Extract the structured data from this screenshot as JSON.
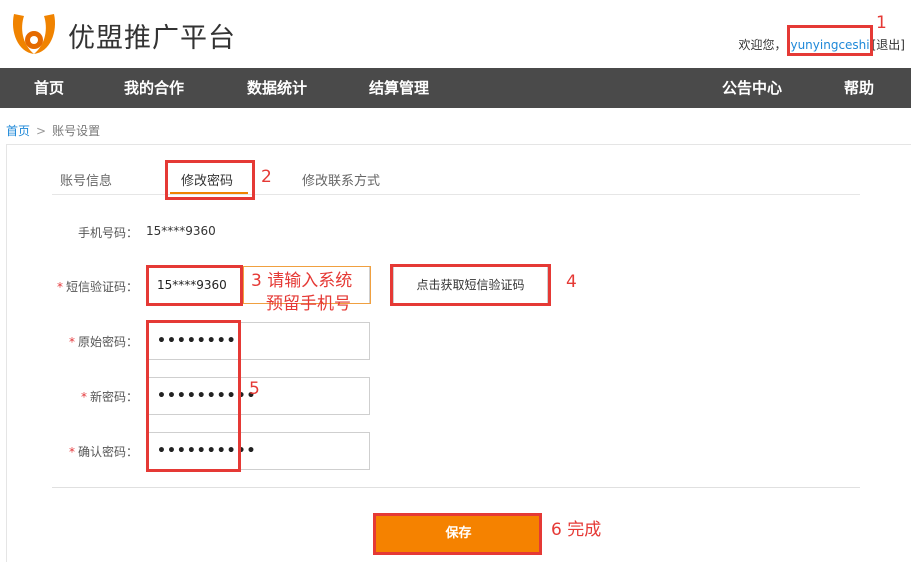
{
  "header": {
    "logo_text": "优盟推广平台",
    "welcome": "欢迎您，",
    "username": "yunyingceshi",
    "logout": "[退出]"
  },
  "nav": {
    "items": [
      "首页",
      "我的合作",
      "数据统计",
      "结算管理",
      "公告中心",
      "帮助"
    ]
  },
  "breadcrumb": {
    "home": "首页",
    "separator": ">",
    "current": "账号设置"
  },
  "tabs": [
    "账号信息",
    "修改密码",
    "修改联系方式"
  ],
  "form": {
    "phone_label": "手机号码：",
    "phone_value": "15****9360",
    "sms_label": "短信验证码：",
    "sms_value": "15****9360",
    "sms_button": "点击获取短信验证码",
    "old_pw_label": "原始密码：",
    "old_pw_value": "••••••••",
    "new_pw_label": "新密码：",
    "new_pw_value": "••••••••••",
    "confirm_pw_label": "确认密码：",
    "confirm_pw_value": "••••••••••",
    "save_button": "保存"
  },
  "annotations": {
    "n1": "1",
    "n2": "2",
    "n3_line1": "3 请输入系统",
    "n3_line2": "预留手机号",
    "n4": "4",
    "n5": "5",
    "n6": "6 完成"
  },
  "colors": {
    "accent": "#f58200",
    "nav_bg": "#4a4a4a",
    "link": "#1e88d8",
    "annotation": "#e53935"
  }
}
